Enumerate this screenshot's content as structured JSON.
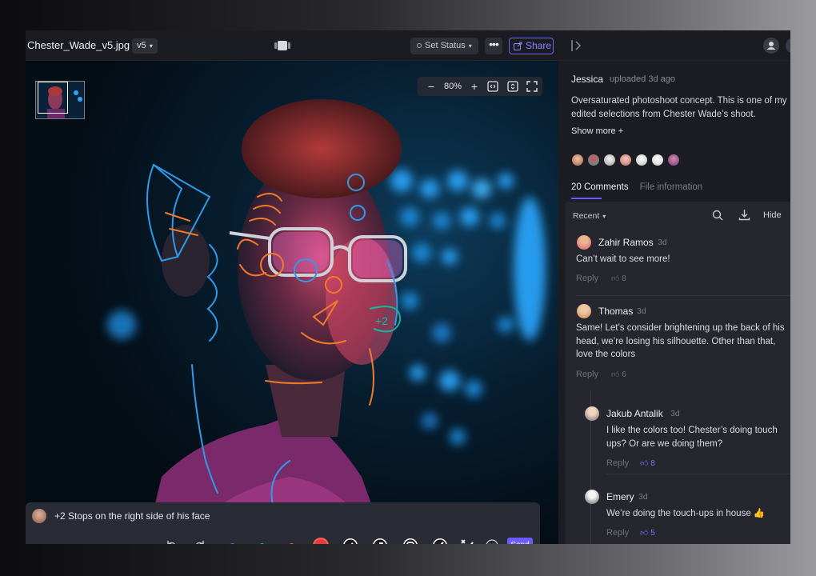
{
  "header": {
    "filename": "Chester_Wade_v5.jpg",
    "version": "v5",
    "set_status": "Set Status",
    "share": "Share",
    "more": "•••"
  },
  "viewer": {
    "zoom": "80%",
    "zoom_minus": "−",
    "zoom_plus": "+"
  },
  "composer": {
    "text": "+2 Stops on the right side of his face",
    "send": "Send",
    "tool_colors": {
      "blue": "#2f8de4",
      "teal": "#17b89a",
      "orange": "#f06a2a",
      "red": "#e83a3a"
    }
  },
  "sidebar": {
    "uploader": "Jessica",
    "uploaded": "uploaded 3d ago",
    "description": "Oversaturated photoshoot concept. This is one of my edited selections from Chester Wade’s shoot.",
    "show_more": "Show more +",
    "tabs": [
      "20 Comments",
      "File information"
    ],
    "sort": "Recent",
    "hide": "Hide",
    "reply_label": "Reply"
  },
  "comments": [
    {
      "name": "Zahir Ramos",
      "time": "3d",
      "text": "Can’t wait to see more!",
      "likes": "8",
      "liked": false
    },
    {
      "name": "Thomas",
      "time": "3d",
      "text": "Same! Let’s consider brightening up the back of his head, we’re losing his silhouette. Other than that, love the colors",
      "likes": "6",
      "liked": false
    },
    {
      "name": "Jakub Antalik",
      "time": "3d",
      "text": "I like the colors too! Chester’s doing touch ups? Or are we doing them?",
      "likes": "8",
      "liked": true
    },
    {
      "name": "Emery",
      "time": "3d",
      "text": "We’re doing the touch-ups in house 👍",
      "likes": "5",
      "liked": true
    }
  ],
  "colors": {
    "accent": "#6b5cff",
    "share": "#8c86ff"
  }
}
